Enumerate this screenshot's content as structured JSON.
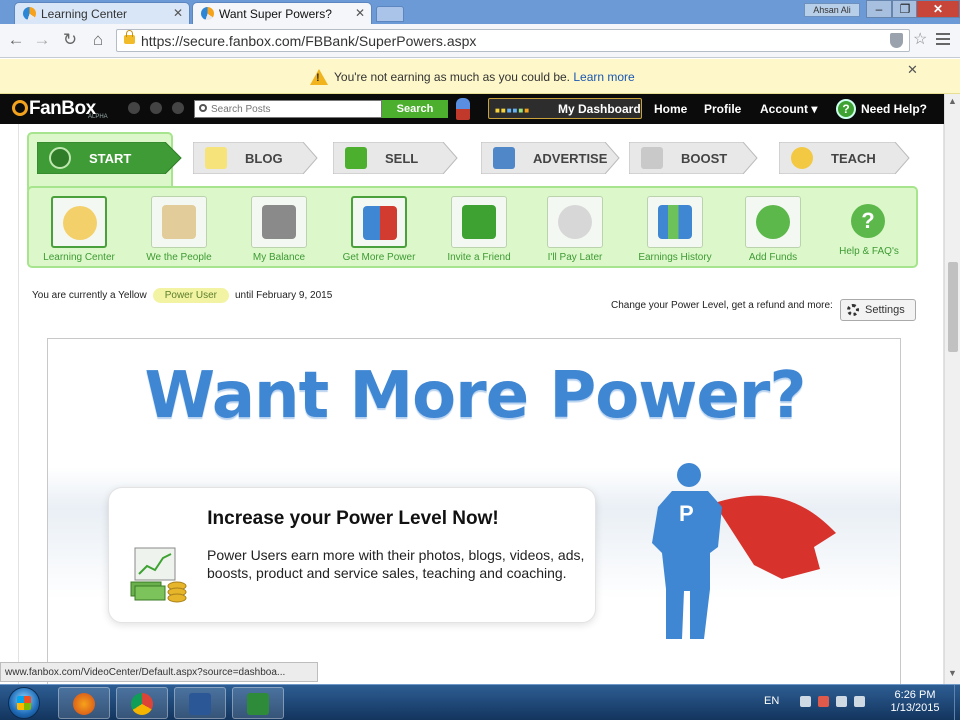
{
  "browser": {
    "tabs": [
      {
        "title": "Learning Center",
        "active": false
      },
      {
        "title": "Want Super Powers?",
        "active": true
      }
    ],
    "user_badge": "Ahsan Ali",
    "url": "https://secure.fanbox.com/FBBank/SuperPowers.aspx",
    "status_url": "www.fanbox.com/VideoCenter/Default.aspx?source=dashboa..."
  },
  "notice": {
    "text": "You're not earning as much as you could be.",
    "link": "Learn more",
    "icon": "warning-icon"
  },
  "sitenav": {
    "logo": "FanBox",
    "logo_sub": "ALPHA",
    "search_placeholder": "Search Posts",
    "search_button": "Search",
    "dashboard": "My Dashboard",
    "links": [
      "Home",
      "Profile",
      "Account ▾"
    ],
    "help": "Need Help?",
    "help_glyph": "?"
  },
  "steps": [
    {
      "label": "START",
      "active": true
    },
    {
      "label": "BLOG",
      "active": false
    },
    {
      "label": "SELL",
      "active": false
    },
    {
      "label": "ADVERTISE",
      "active": false
    },
    {
      "label": "BOOST",
      "active": false
    },
    {
      "label": "TEACH",
      "active": false
    }
  ],
  "subnav": [
    {
      "label": "Learning Center",
      "icon": "teacher-icon",
      "selected": true
    },
    {
      "label": "We the People",
      "icon": "constitution-icon",
      "selected": false
    },
    {
      "label": "My Balance",
      "icon": "bank-icon",
      "selected": false
    },
    {
      "label": "Get More Power",
      "icon": "superhero-icon",
      "selected": true
    },
    {
      "label": "Invite a Friend",
      "icon": "envelope-icon",
      "selected": false
    },
    {
      "label": "I'll Pay Later",
      "icon": "stopwatch-icon",
      "selected": false
    },
    {
      "label": "Earnings History",
      "icon": "bar-chart-icon",
      "selected": false
    },
    {
      "label": "Add Funds",
      "icon": "add-funds-icon",
      "selected": false
    },
    {
      "label": "Help & FAQ's",
      "icon": "help-icon",
      "selected": false
    }
  ],
  "status": {
    "prefix": "You are currently a Yellow",
    "badge": "Power User",
    "suffix": "until February 9, 2015",
    "settings_text": "Change your Power Level, get a refund and more:",
    "settings_button": "Settings"
  },
  "banner": {
    "headline": "Want More Power?",
    "card_title": "Increase your Power Level Now!",
    "card_text": "Power Users earn more with their photos, blogs, videos, ads, boosts, product and service sales, teaching and coaching.",
    "hero_letter": "P"
  },
  "taskbar": {
    "lang": "EN",
    "time": "6:26 PM",
    "date": "1/13/2015"
  },
  "colors": {
    "accent_blue": "#3f86d3",
    "green": "#4caf2e",
    "nav_bg": "#0b0b0b",
    "notice_bg": "#fdf7c9",
    "subnav_bg": "#dcf7c9"
  }
}
